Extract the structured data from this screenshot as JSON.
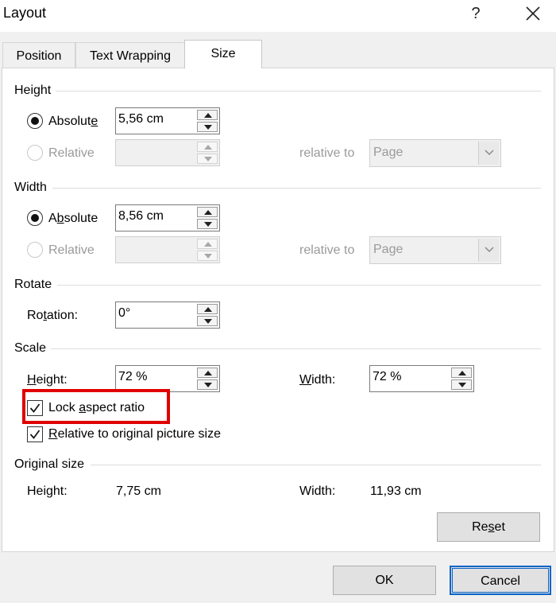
{
  "window": {
    "title": "Layout",
    "help": "?"
  },
  "tabs": [
    {
      "label": "Position",
      "active": false
    },
    {
      "label": "Text Wrapping",
      "active": false
    },
    {
      "label": "Size",
      "active": true
    }
  ],
  "height": {
    "section": "Height",
    "absolute_label_pre": "Absolut",
    "absolute_label_u": "e",
    "absolute_value": "5,56 cm",
    "relative_label": "Relative",
    "relative_value": "",
    "relative_to_label": "relative to",
    "relative_to_value": "Page"
  },
  "width": {
    "section": "Width",
    "absolute_label_pre": "A",
    "absolute_label_u": "b",
    "absolute_label_post": "solute",
    "absolute_value": "8,56 cm",
    "relative_label": "Relative",
    "relative_value": "",
    "relative_to_label": "relative to",
    "relative_to_value": "Page"
  },
  "rotate": {
    "section": "Rotate",
    "rotation_label_pre": "Ro",
    "rotation_label_u": "t",
    "rotation_label_post": "ation:",
    "rotation_value": "0°"
  },
  "scale": {
    "section": "Scale",
    "height_label_u": "H",
    "height_label_post": "eight:",
    "height_value": "72 %",
    "width_label_u": "W",
    "width_label_post": "idth:",
    "width_value": "72 %",
    "lock_label_pre": "Lock ",
    "lock_label_u": "a",
    "lock_label_post": "spect ratio",
    "lock_checked": true,
    "relative_label_u": "R",
    "relative_label_post": "elative to original picture size",
    "relative_checked": true
  },
  "original": {
    "section": "Original size",
    "height_label": "Height:",
    "height_value": "7,75 cm",
    "width_label": "Width:",
    "width_value": "11,93 cm"
  },
  "buttons": {
    "reset_pre": "Re",
    "reset_u": "s",
    "reset_post": "et",
    "ok": "OK",
    "cancel": "Cancel"
  },
  "colors": {
    "highlight": "#e00000",
    "default_button_border": "#0a64c8"
  }
}
